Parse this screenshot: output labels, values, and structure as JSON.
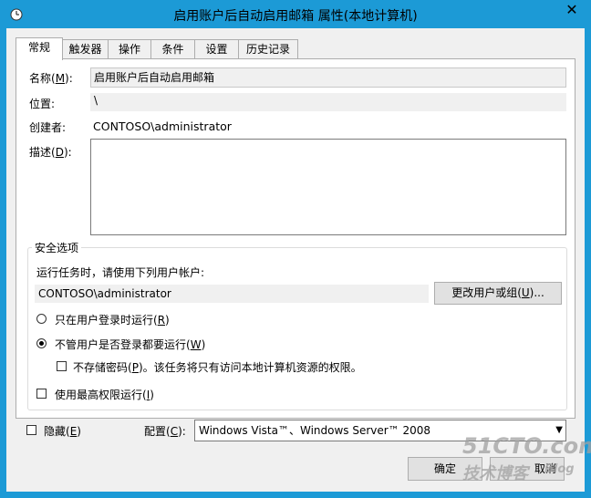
{
  "window": {
    "title": "启用账户后自动启用邮箱 属性(本地计算机)",
    "close_symbol": "✕"
  },
  "tabs": [
    {
      "label": "常规",
      "active": true
    },
    {
      "label": "触发器",
      "active": false
    },
    {
      "label": "操作",
      "active": false
    },
    {
      "label": "条件",
      "active": false
    },
    {
      "label": "设置",
      "active": false
    },
    {
      "label": "历史记录",
      "active": false
    }
  ],
  "general": {
    "name_label": "名称(",
    "name_key": "M",
    "name_label_end": "):",
    "name_value": "启用账户后自动启用邮箱",
    "location_label": "位置:",
    "location_value": "\\",
    "author_label": "创建者:",
    "author_value": "CONTOSO\\administrator",
    "description_label": "描述(",
    "description_key": "D",
    "description_label_end": "):",
    "description_value": ""
  },
  "security": {
    "group_title": "安全选项",
    "run_as_prompt": "运行任务时，请使用下列用户帐户:",
    "user_account": "CONTOSO\\administrator",
    "change_user_button": {
      "label": "更改用户或组(",
      "key": "U",
      "label_end": ")..."
    },
    "radio_logged_on": {
      "label": "只在用户登录时运行(",
      "key": "R",
      "label_end": ")",
      "checked": false
    },
    "radio_whether_logged_on": {
      "label": "不管用户是否登录都要运行(",
      "key": "W",
      "label_end": ")",
      "checked": true
    },
    "no_store_password": {
      "label": "不存储密码(",
      "key": "P",
      "label_end": ")。该任务将只有访问本地计算机资源的权限。",
      "checked": false
    },
    "highest_privileges": {
      "label": "使用最高权限运行(",
      "key": "I",
      "label_end": ")",
      "checked": false
    }
  },
  "bottom": {
    "hidden": {
      "label": "隐藏(",
      "key": "E",
      "label_end": ")",
      "checked": false
    },
    "configure_label": "配置(",
    "configure_key": "C",
    "configure_label_end": "):",
    "configure_value": "Windows Vista™、Windows Server™ 2008",
    "ok_button": "确定",
    "cancel_button": "取消"
  },
  "watermark": {
    "site": "51CTO.com",
    "tagline": "技术博客",
    "blog": "Blog"
  },
  "colors": {
    "title_bar": "#1c9ad6",
    "dialog_bg": "#f0f0f0"
  }
}
